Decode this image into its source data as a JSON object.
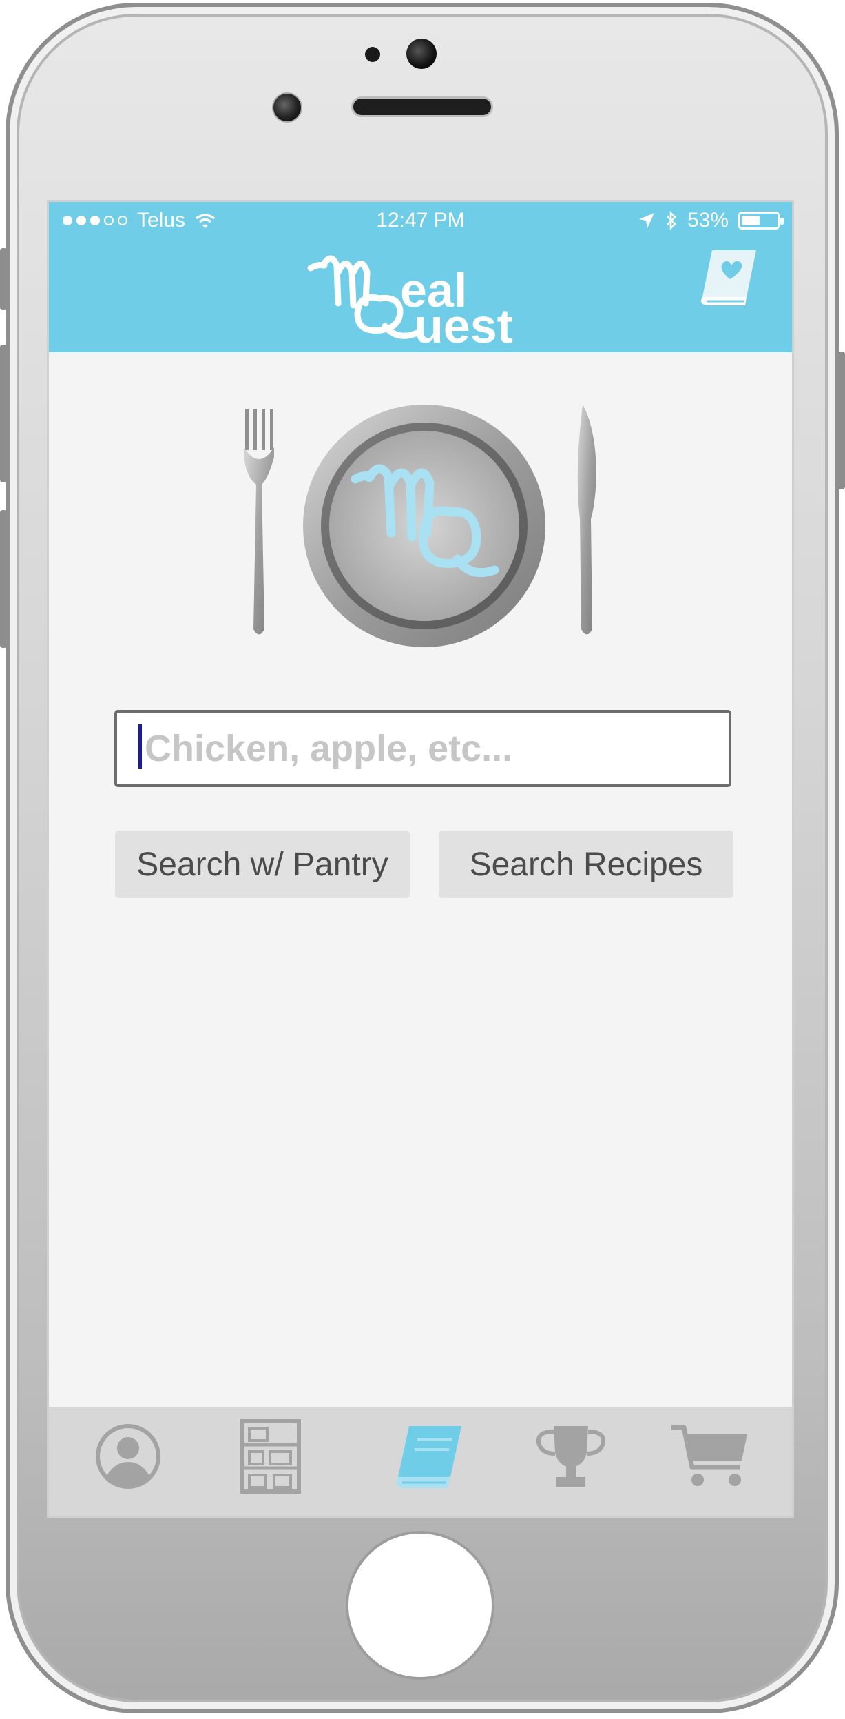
{
  "status_bar": {
    "carrier": "Telus",
    "time": "12:47 PM",
    "battery": "53%",
    "battery_level": 0.53,
    "signal_bars": 3,
    "signal_total": 5
  },
  "header": {
    "logo_line1": "eal",
    "logo_line2": "uest",
    "logo_initials": "MQ",
    "background_color": "#70cde8",
    "favorites_icon": "heart-book-icon"
  },
  "hero": {
    "plate_initials": "MQ",
    "accent_color": "#a9e1f2"
  },
  "search": {
    "placeholder": "Chicken, apple, etc...",
    "value": ""
  },
  "buttons": {
    "pantry_label": "Search w/ Pantry",
    "recipes_label": "Search Recipes"
  },
  "tabbar": {
    "tabs": [
      {
        "icon": "profile-icon",
        "active": false
      },
      {
        "icon": "pantry-shelf-icon",
        "active": false
      },
      {
        "icon": "recipe-book-icon",
        "active": true
      },
      {
        "icon": "trophy-icon",
        "active": false
      },
      {
        "icon": "cart-icon",
        "active": false
      }
    ],
    "active_color": "#70cde8",
    "inactive_color": "#a3a3a3"
  }
}
